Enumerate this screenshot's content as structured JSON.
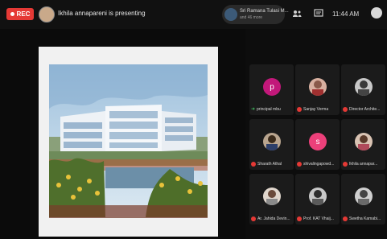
{
  "topbar": {
    "rec_label": "REC",
    "presenter_status": "Ikhila annapareni is presenting",
    "pinned": {
      "name": "Sri Ramana Tulasi M...",
      "subtitle": "and 46 more"
    },
    "time": "11:44 AM",
    "icons": [
      "people-icon",
      "chat-icon"
    ]
  },
  "participants": [
    {
      "name": "principal mbu",
      "avatar": "initial",
      "color": "#c2187a",
      "initial": "p",
      "indicator": "arrow"
    },
    {
      "name": "Sanjay Verma",
      "avatar": "photo",
      "color": "#e53935",
      "initial": "",
      "indicator": "mic"
    },
    {
      "name": "Director Archite...",
      "avatar": "photo",
      "color": "#e53935",
      "initial": "",
      "indicator": "mic"
    },
    {
      "name": "Sharath Athal",
      "avatar": "photo",
      "color": "#e53935",
      "initial": "",
      "indicator": "mic"
    },
    {
      "name": "shivalingapowd...",
      "avatar": "initial",
      "color": "#ec407a",
      "initial": "s",
      "indicator": "mic"
    },
    {
      "name": "Ikhila annapar...",
      "avatar": "photo",
      "color": "#e53935",
      "initial": "",
      "indicator": "mic"
    },
    {
      "name": "Ar. Jahida Devin...",
      "avatar": "photo",
      "color": "#e53935",
      "initial": "",
      "indicator": "mic"
    },
    {
      "name": "Prof. KAT Vhaij...",
      "avatar": "photo",
      "color": "#e53935",
      "initial": "",
      "indicator": "mic"
    },
    {
      "name": "Swetha Kamabi...",
      "avatar": "photo",
      "color": "#e53935",
      "initial": "",
      "indicator": "mic"
    }
  ]
}
